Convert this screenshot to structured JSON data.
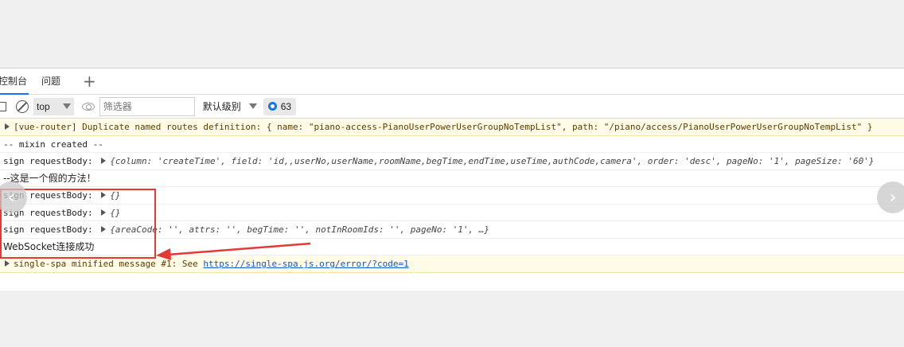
{
  "tabs": {
    "console": "控制台",
    "issues": "问题",
    "add": "+"
  },
  "toolbar": {
    "context": "top",
    "filter_placeholder": "筛选器",
    "level": "默认级别",
    "message_count": "63"
  },
  "console": {
    "router_warning": "[vue-router] Duplicate named routes definition: { name: \"piano-access-PianoUserPowerUserGroupNoTempList\", path: \"/piano/access/PianoUserPowerUserGroupNoTempList\" }",
    "mixin": " -- mixin created --",
    "sign1_label": "sign requestBody: ",
    "sign1_obj": "{column: 'createTime', field: 'id,,userNo,userName,roomName,begTime,endTime,useTime,authCode,camera', order: 'desc', pageNo: '1', pageSize: '60'}",
    "fake_method": "--这是一个假的方法！",
    "sign2_label": "sign requestBody: ",
    "sign2_obj": "{}",
    "sign3_label": "sign requestBody: ",
    "sign3_obj": "{}",
    "sign4_label": "sign requestBody: ",
    "sign4_obj": "{areaCode: '', attrs: '', begTime: '', notInRoomIds: '', pageNo: '1', …}",
    "websocket": "WebSocket连接成功",
    "spa_prefix": "single-spa minified message #1: See ",
    "spa_link": "https://single-spa.js.org/error/?code=1"
  },
  "nav": {
    "prev": "‹",
    "next": "›"
  },
  "colors": {
    "annotation": "#e53935",
    "accent": "#1a73e8"
  }
}
